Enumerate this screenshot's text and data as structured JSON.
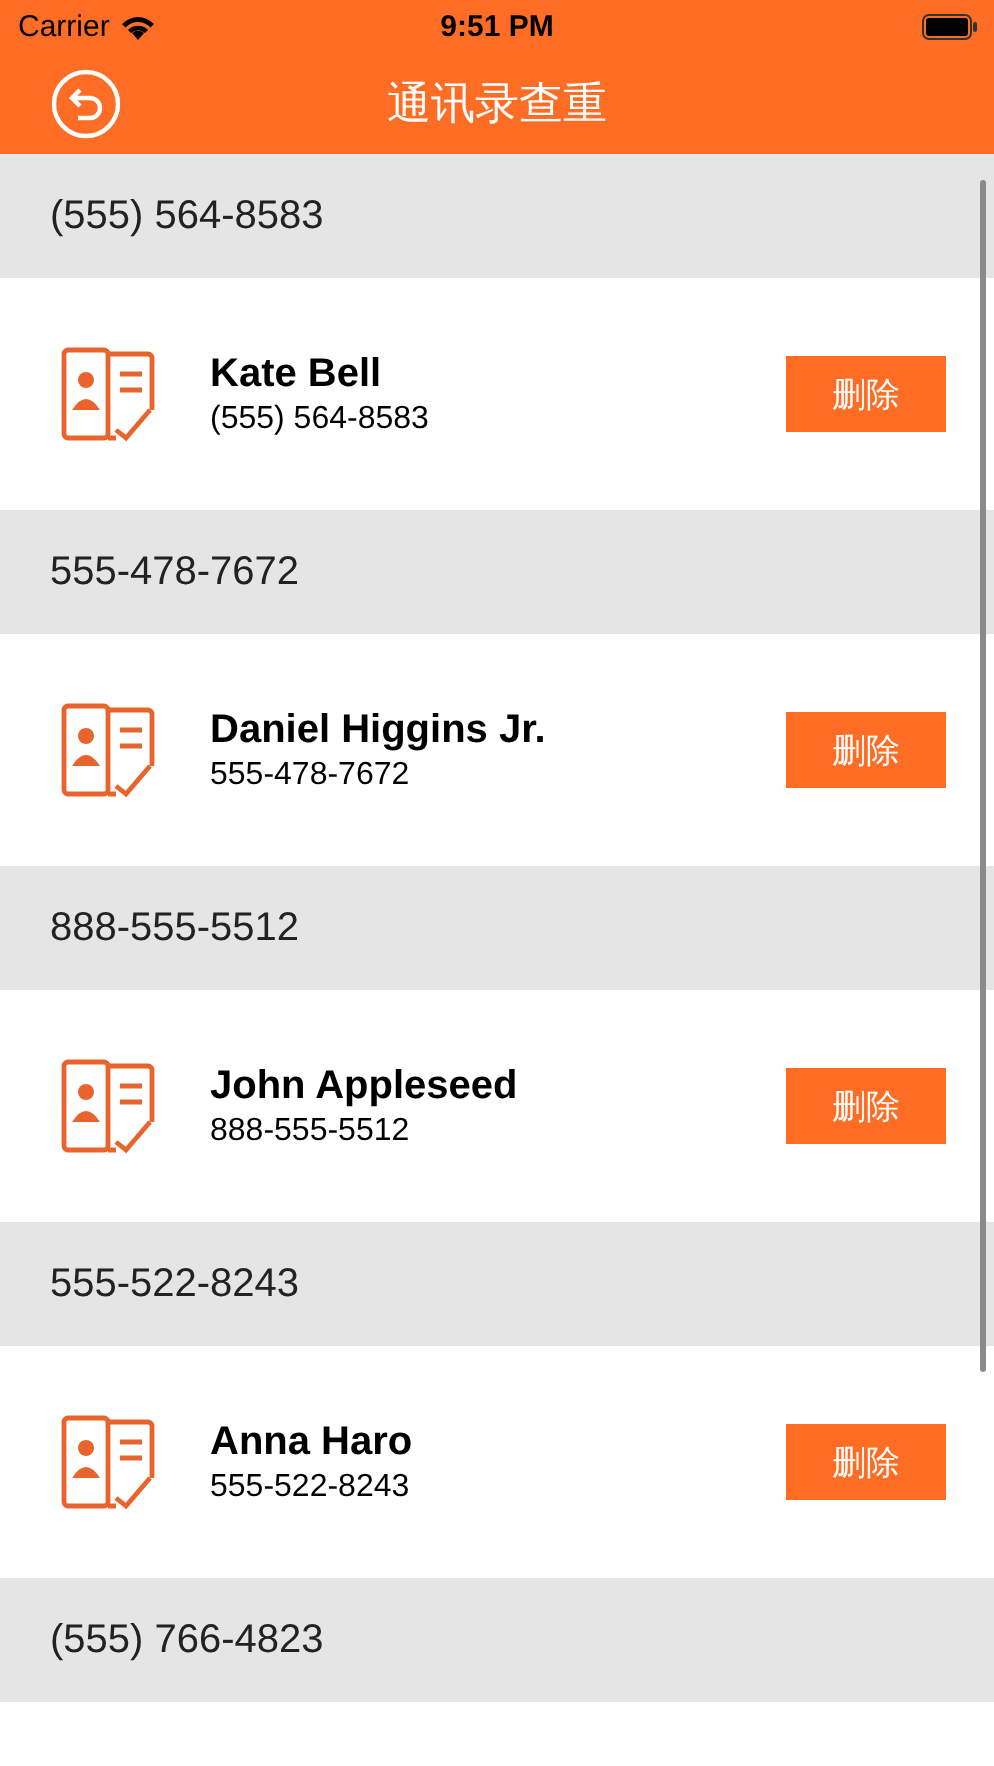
{
  "status_bar": {
    "carrier": "Carrier",
    "time": "9:51 PM"
  },
  "nav_bar": {
    "title": "通讯录查重"
  },
  "sections": [
    {
      "header": "(555) 564-8583",
      "contacts": [
        {
          "name": "Kate Bell",
          "phone": "(555) 564-8583",
          "action": "删除"
        }
      ]
    },
    {
      "header": "555-478-7672",
      "contacts": [
        {
          "name": "Daniel Higgins Jr.",
          "phone": "555-478-7672",
          "action": "删除"
        }
      ]
    },
    {
      "header": "888-555-5512",
      "contacts": [
        {
          "name": "John Appleseed",
          "phone": "888-555-5512",
          "action": "删除"
        }
      ]
    },
    {
      "header": "555-522-8243",
      "contacts": [
        {
          "name": "Anna Haro",
          "phone": "555-522-8243",
          "action": "删除"
        }
      ]
    },
    {
      "header": "(555) 766-4823"
    }
  ]
}
